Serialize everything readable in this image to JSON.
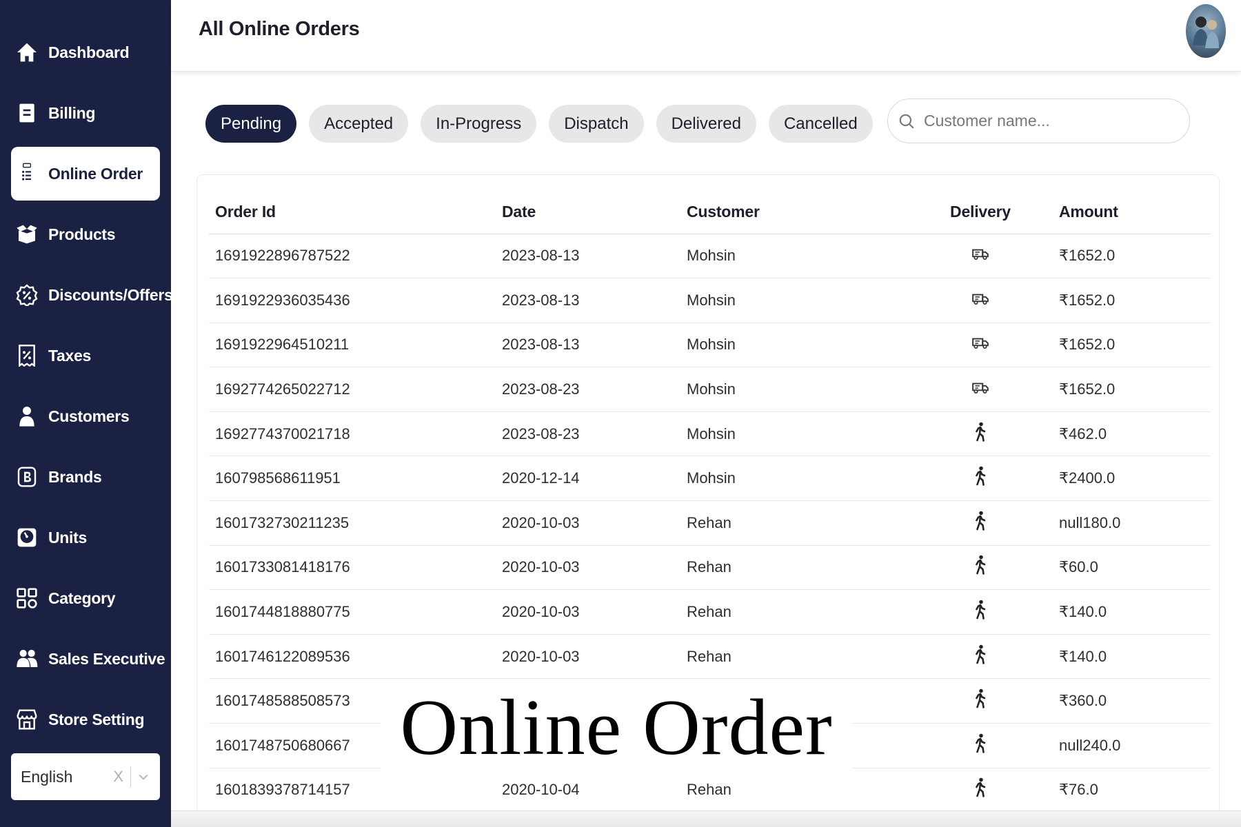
{
  "header": {
    "title": "All Online Orders"
  },
  "sidebar": {
    "items": [
      {
        "label": "Dashboard",
        "icon": "home-icon",
        "active": false
      },
      {
        "label": "Billing",
        "icon": "billing-icon",
        "active": false
      },
      {
        "label": "Online Order",
        "icon": "clipboard-list-icon",
        "active": true
      },
      {
        "label": "Products",
        "icon": "box-icon",
        "active": false
      },
      {
        "label": "Discounts/Offers",
        "icon": "discount-badge-icon",
        "active": false
      },
      {
        "label": "Taxes",
        "icon": "tax-receipt-icon",
        "active": false
      },
      {
        "label": "Customers",
        "icon": "person-icon",
        "active": false
      },
      {
        "label": "Brands",
        "icon": "brand-b-icon",
        "active": false
      },
      {
        "label": "Units",
        "icon": "scale-icon",
        "active": false
      },
      {
        "label": "Category",
        "icon": "grid-icon",
        "active": false
      },
      {
        "label": "Sales Executive",
        "icon": "group-icon",
        "active": false
      },
      {
        "label": "Store Setting",
        "icon": "store-icon",
        "active": false
      }
    ],
    "language": {
      "value": "English",
      "clear": "X"
    }
  },
  "filters": {
    "tabs": [
      "Pending",
      "Accepted",
      "In-Progress",
      "Dispatch",
      "Delivered",
      "Cancelled"
    ],
    "active": "Pending"
  },
  "search": {
    "placeholder": "Customer name..."
  },
  "table": {
    "headers": [
      "Order Id",
      "Date",
      "Customer",
      "Delivery",
      "Amount"
    ],
    "rows": [
      {
        "id": "1691922896787522",
        "date": "2023-08-13",
        "customer": "Mohsin",
        "delivery": "delivery-truck-icon",
        "amount": "₹1652.0"
      },
      {
        "id": "1691922936035436",
        "date": "2023-08-13",
        "customer": "Mohsin",
        "delivery": "delivery-truck-icon",
        "amount": "₹1652.0"
      },
      {
        "id": "1691922964510211",
        "date": "2023-08-13",
        "customer": "Mohsin",
        "delivery": "delivery-truck-icon",
        "amount": "₹1652.0"
      },
      {
        "id": "1692774265022712",
        "date": "2023-08-23",
        "customer": "Mohsin",
        "delivery": "delivery-truck-icon",
        "amount": "₹1652.0"
      },
      {
        "id": "1692774370021718",
        "date": "2023-08-23",
        "customer": "Mohsin",
        "delivery": "pickup-walk-icon",
        "amount": "₹462.0"
      },
      {
        "id": "160798568611951",
        "date": "2020-12-14",
        "customer": "Mohsin",
        "delivery": "pickup-walk-icon",
        "amount": "₹2400.0"
      },
      {
        "id": "1601732730211235",
        "date": "2020-10-03",
        "customer": "Rehan",
        "delivery": "pickup-walk-icon",
        "amount": "null180.0"
      },
      {
        "id": "1601733081418176",
        "date": "2020-10-03",
        "customer": "Rehan",
        "delivery": "pickup-walk-icon",
        "amount": "₹60.0"
      },
      {
        "id": "1601744818880775",
        "date": "2020-10-03",
        "customer": "Rehan",
        "delivery": "pickup-walk-icon",
        "amount": "₹140.0"
      },
      {
        "id": "1601746122089536",
        "date": "2020-10-03",
        "customer": "Rehan",
        "delivery": "pickup-walk-icon",
        "amount": "₹140.0"
      },
      {
        "id": "1601748588508573",
        "date": "",
        "customer": "",
        "delivery": "pickup-walk-icon",
        "amount": "₹360.0"
      },
      {
        "id": "1601748750680667",
        "date": "",
        "customer": "",
        "delivery": "pickup-walk-icon",
        "amount": "null240.0"
      },
      {
        "id": "1601839378714157",
        "date": "2020-10-04",
        "customer": "Rehan",
        "delivery": "pickup-walk-icon",
        "amount": "₹76.0"
      }
    ]
  },
  "caption": "Online Order",
  "colors": {
    "sidebar": "#1a2142",
    "active_tab": "#1a2142",
    "tab_bg": "#e7e7e7"
  }
}
